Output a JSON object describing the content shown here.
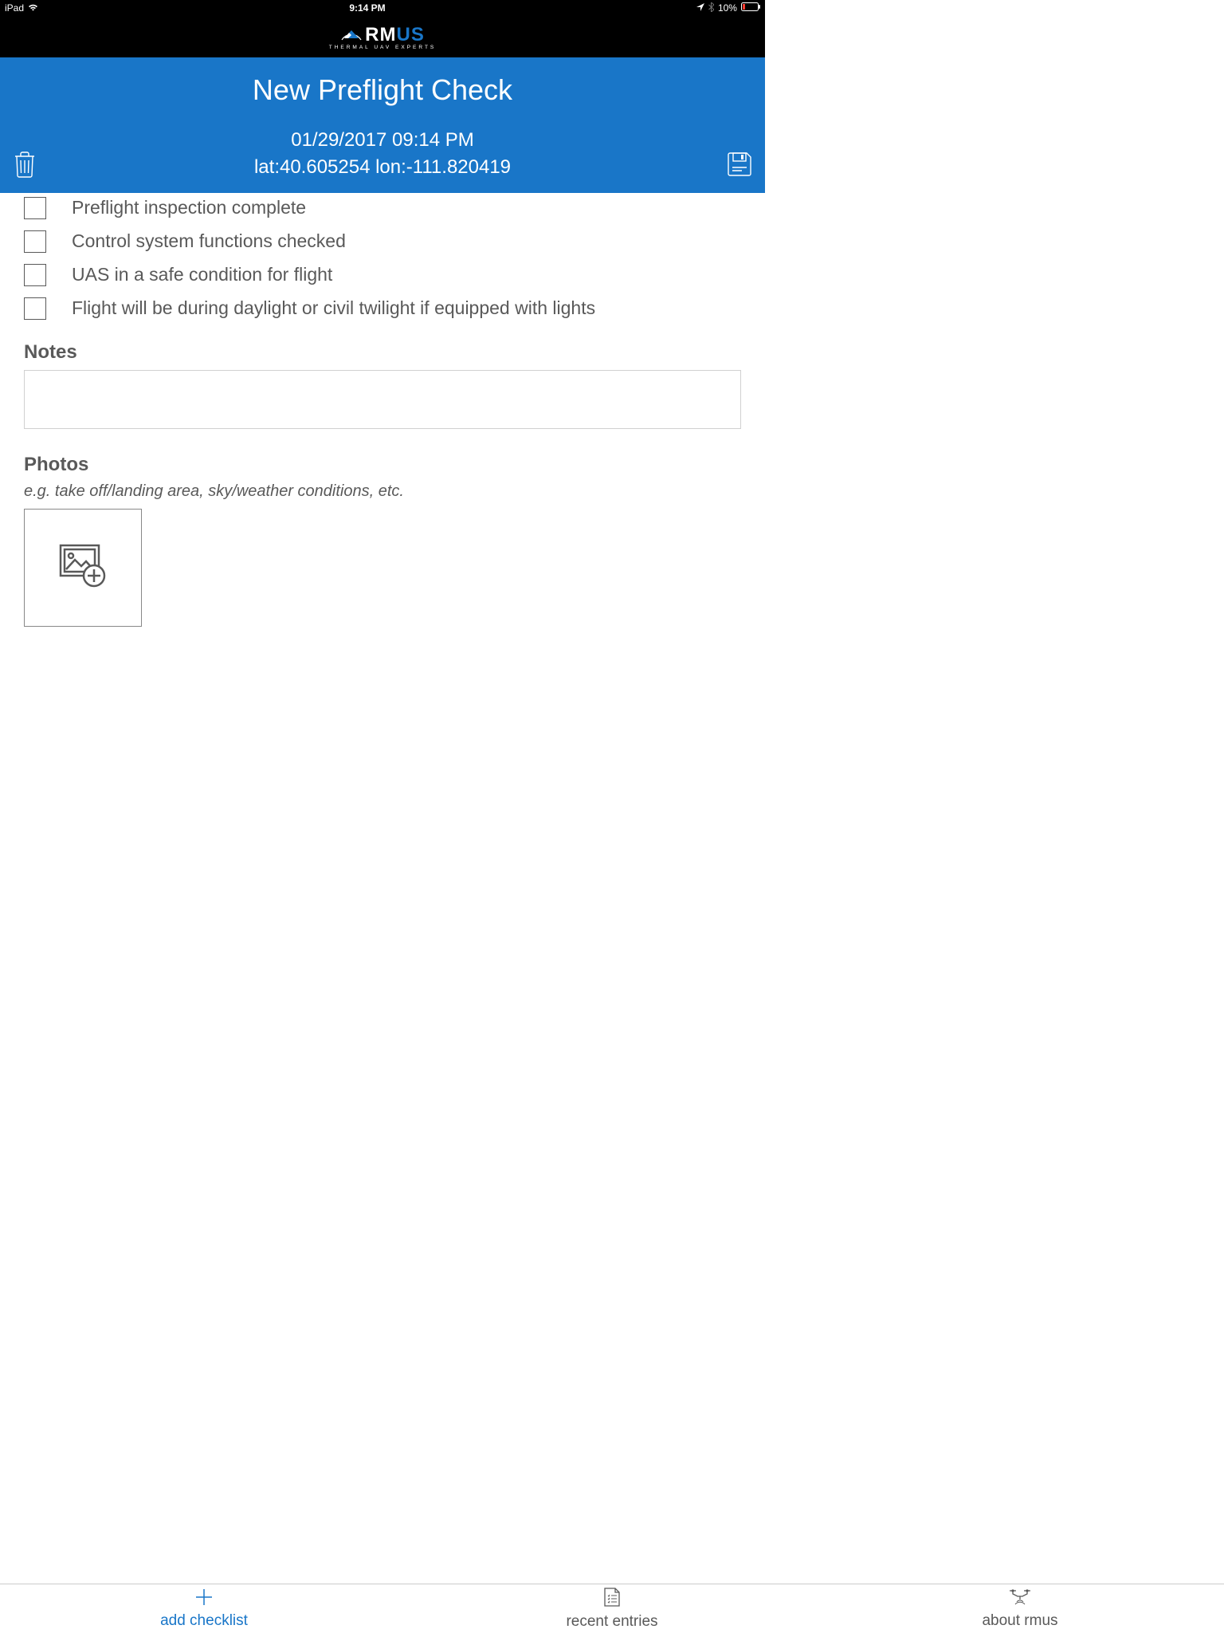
{
  "status_bar": {
    "device": "iPad",
    "time": "9:14 PM",
    "battery_pct": "10%"
  },
  "logo": {
    "brand_prefix": "RM",
    "brand_suffix": "US",
    "tagline": "THERMAL UAV EXPERTS"
  },
  "header": {
    "title": "New Preflight Check",
    "datetime": "01/29/2017 09:14 PM",
    "location": "lat:40.605254 lon:-111.820419"
  },
  "checklist": [
    {
      "label": "Preflight inspection complete",
      "checked": false
    },
    {
      "label": "Control system functions checked",
      "checked": false
    },
    {
      "label": "UAS in a safe condition for flight",
      "checked": false
    },
    {
      "label": "Flight will be during daylight or civil twilight if equipped with lights",
      "checked": false
    }
  ],
  "notes": {
    "heading": "Notes",
    "value": ""
  },
  "photos": {
    "heading": "Photos",
    "hint": "e.g. take off/landing area, sky/weather conditions, etc."
  },
  "tabbar": {
    "add_checklist": "add checklist",
    "recent_entries": "recent entries",
    "about_rmus": "about rmus"
  }
}
